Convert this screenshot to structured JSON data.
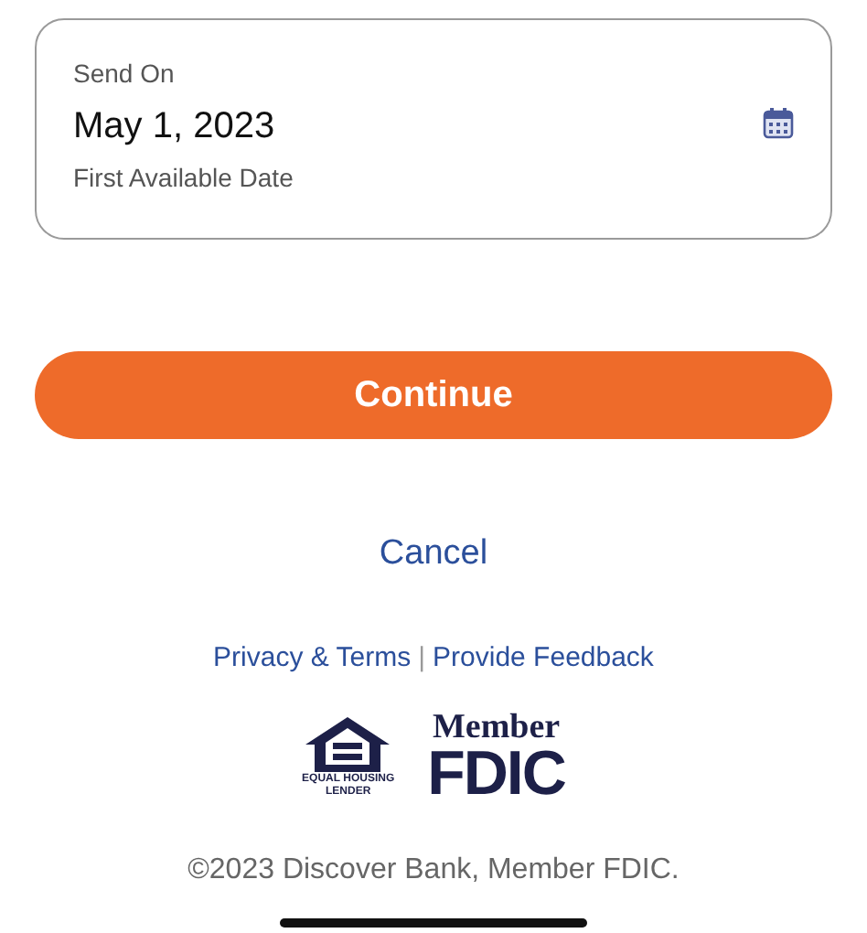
{
  "date_field": {
    "label": "Send On",
    "value": "May 1, 2023",
    "hint": "First Available Date"
  },
  "continue_button": "Continue",
  "cancel_link": "Cancel",
  "footer_links": [
    "Privacy & Terms",
    "Provide Feedback"
  ],
  "footer_separator": "|",
  "logos": {
    "equal_housing": [
      "EQUAL HOUSING",
      "LENDER"
    ],
    "fdic": [
      "Member",
      "FDIC"
    ]
  },
  "copyright": "©2023 Discover Bank, Member FDIC."
}
